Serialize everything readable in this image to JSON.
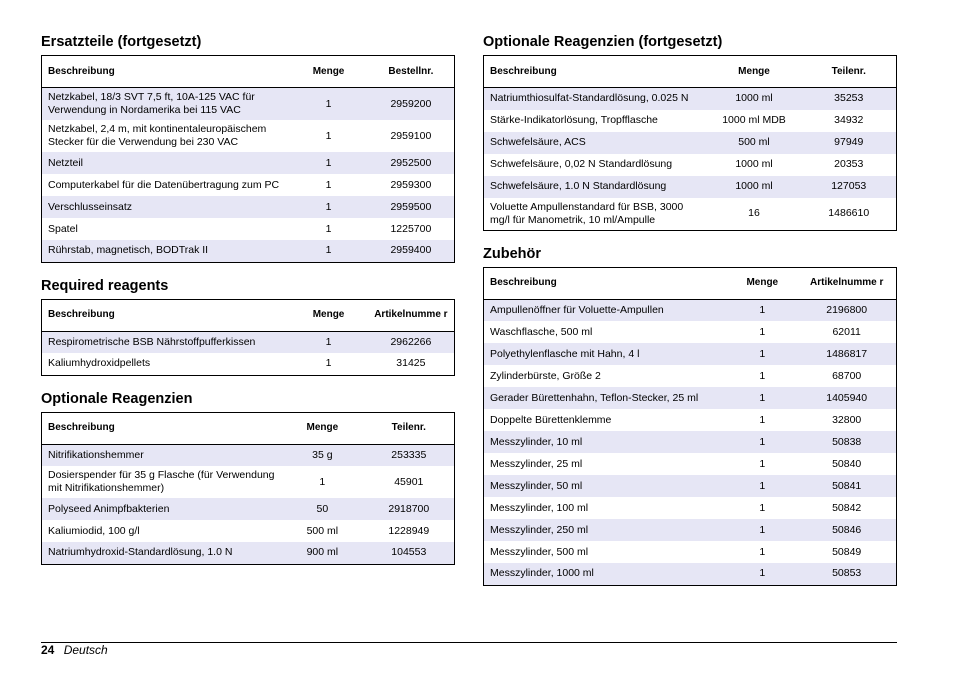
{
  "ersatzteile": {
    "title": "Ersatzteile (fortgesetzt)",
    "headers": [
      "Beschreibung",
      "Menge",
      "Bestellnr."
    ],
    "rows": [
      [
        "Netzkabel, 18/3 SVT 7,5 ft, 10A-125 VAC für Verwendung in Nordamerika bei 115 VAC",
        "1",
        "2959200"
      ],
      [
        "Netzkabel, 2,4 m, mit kontinentaleuropäischem Stecker für die Verwendung bei 230 VAC",
        "1",
        "2959100"
      ],
      [
        "Netzteil",
        "1",
        "2952500"
      ],
      [
        "Computerkabel für die Datenübertragung zum PC",
        "1",
        "2959300"
      ],
      [
        "Verschlusseinsatz",
        "1",
        "2959500"
      ],
      [
        "Spatel",
        "1",
        "1225700"
      ],
      [
        "Rührstab, magnetisch, BODTrak II",
        "1",
        "2959400"
      ]
    ]
  },
  "required": {
    "title": "Required reagents",
    "headers": [
      "Beschreibung",
      "Menge",
      "Artikelnumme r"
    ],
    "rows": [
      [
        "Respirometrische BSB Nährstoffpufferkissen",
        "1",
        "2962266"
      ],
      [
        "Kaliumhydroxidpellets",
        "1",
        "31425"
      ]
    ]
  },
  "optional": {
    "title": "Optionale Reagenzien",
    "headers": [
      "Beschreibung",
      "Menge",
      "Teilenr."
    ],
    "rows": [
      [
        "Nitrifikationshemmer",
        "35 g",
        "253335"
      ],
      [
        "Dosierspender für 35 g Flasche (für Verwendung mit Nitrifikationshemmer)",
        "1",
        "45901"
      ],
      [
        "Polyseed Animpfbakterien",
        "50",
        "2918700"
      ],
      [
        "Kaliumiodid, 100 g/l",
        "500 ml",
        "1228949"
      ],
      [
        "Natriumhydroxid-Standardlösung, 1.0 N",
        "900 ml",
        "104553"
      ]
    ]
  },
  "optional_cont": {
    "title": "Optionale Reagenzien (fortgesetzt)",
    "headers": [
      "Beschreibung",
      "Menge",
      "Teilenr."
    ],
    "rows": [
      [
        "Natriumthiosulfat-Standardlösung, 0.025 N",
        "1000 ml",
        "35253"
      ],
      [
        "Stärke-Indikatorlösung, Tropfflasche",
        "1000 ml MDB",
        "34932"
      ],
      [
        "Schwefelsäure, ACS",
        "500 ml",
        "97949"
      ],
      [
        "Schwefelsäure, 0,02 N Standardlösung",
        "1000 ml",
        "20353"
      ],
      [
        "Schwefelsäure, 1.0 N Standardlösung",
        "1000 ml",
        "127053"
      ],
      [
        "Voluette Ampullenstandard für BSB, 3000 mg/l für Manometrik, 10 ml/Ampulle",
        "16",
        "1486610"
      ]
    ]
  },
  "zubehoer": {
    "title": "Zubehör",
    "headers": [
      "Beschreibung",
      "Menge",
      "Artikelnumme r"
    ],
    "rows": [
      [
        "Ampullenöffner für Voluette-Ampullen",
        "1",
        "2196800"
      ],
      [
        "Waschflasche, 500 ml",
        "1",
        "62011"
      ],
      [
        "Polyethylenflasche mit Hahn, 4 l",
        "1",
        "1486817"
      ],
      [
        "Zylinderbürste, Größe 2",
        "1",
        "68700"
      ],
      [
        "Gerader Bürettenhahn, Teflon-Stecker, 25 ml",
        "1",
        "1405940"
      ],
      [
        "Doppelte Bürettenklemme",
        "1",
        "32800"
      ],
      [
        "Messzylinder, 10 ml",
        "1",
        "50838"
      ],
      [
        "Messzylinder, 25 ml",
        "1",
        "50840"
      ],
      [
        "Messzylinder, 50 ml",
        "1",
        "50841"
      ],
      [
        "Messzylinder, 100 ml",
        "1",
        "50842"
      ],
      [
        "Messzylinder, 250 ml",
        "1",
        "50846"
      ],
      [
        "Messzylinder, 500 ml",
        "1",
        "50849"
      ],
      [
        "Messzylinder, 1000 ml",
        "1",
        "50853"
      ]
    ]
  },
  "footer": {
    "page_number": "24",
    "language": "Deutsch"
  },
  "colors": {
    "row_shade": "#e6e6f5"
  }
}
